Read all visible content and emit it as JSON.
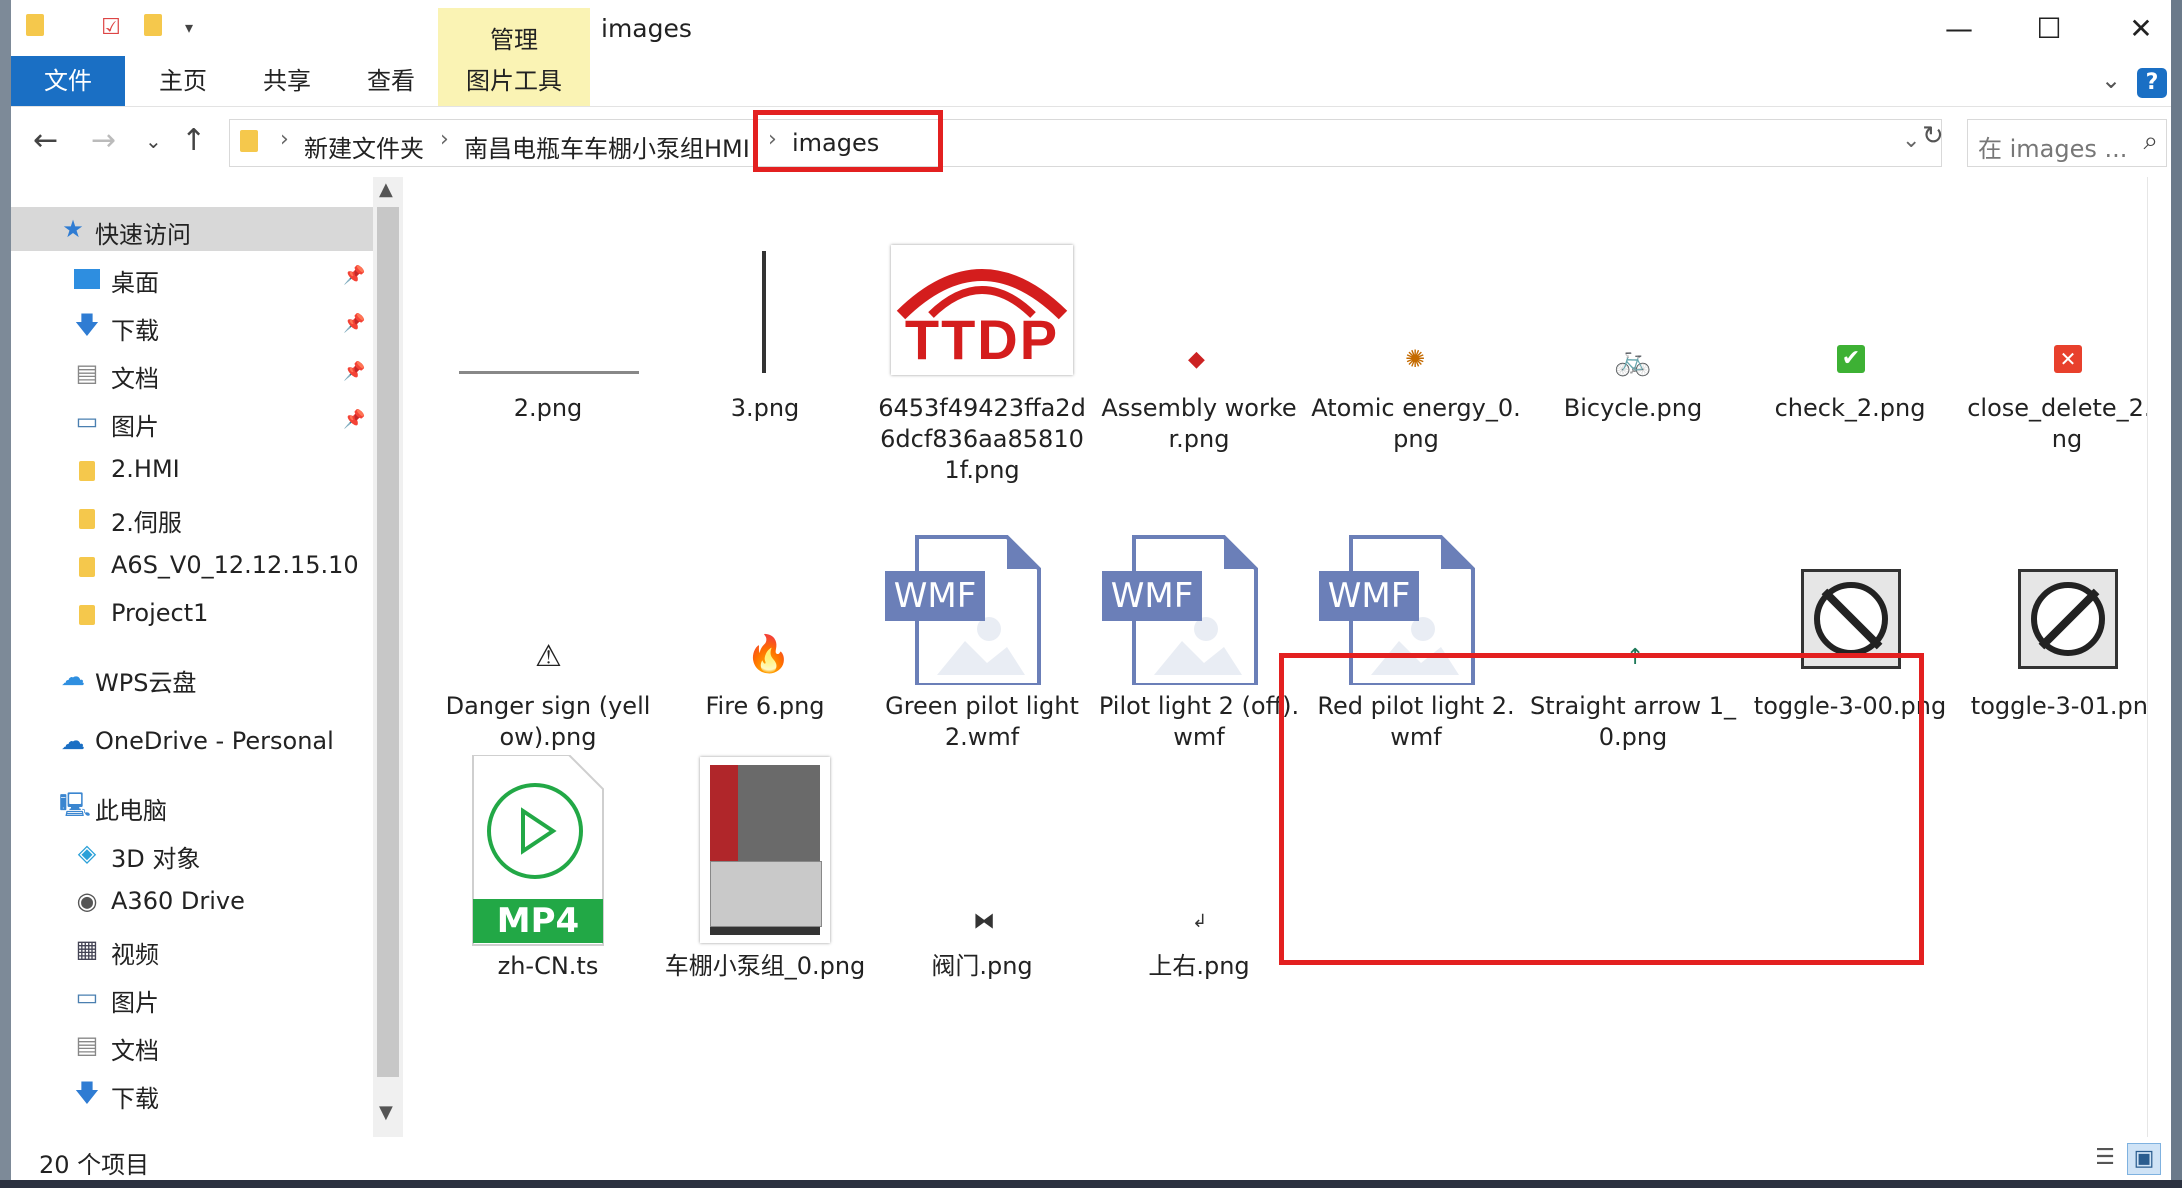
{
  "window": {
    "title": "images",
    "manage_tab": "管理",
    "controls": {
      "minimize": "—",
      "maximize": "☐",
      "close": "✕"
    }
  },
  "ribbon": {
    "tabs": [
      "文件",
      "主页",
      "共享",
      "查看",
      "图片工具"
    ],
    "help": "?",
    "collapse": "⌄"
  },
  "address": {
    "crumbs": [
      "新建文件夹",
      "南昌电瓶车车棚小泵组HMI",
      "images"
    ],
    "search_placeholder": "在 images ...",
    "refresh": "↻"
  },
  "navigation": {
    "items": [
      {
        "label": "快速访问",
        "icon": "star-icon",
        "level": 0,
        "selected": true
      },
      {
        "label": "桌面",
        "icon": "desktop-icon",
        "level": 1,
        "pinned": true
      },
      {
        "label": "下载",
        "icon": "download-icon",
        "level": 1,
        "pinned": true
      },
      {
        "label": "文档",
        "icon": "document-icon",
        "level": 1,
        "pinned": true
      },
      {
        "label": "图片",
        "icon": "pictures-icon",
        "level": 1,
        "pinned": true
      },
      {
        "label": "2.HMI",
        "icon": "folder-icon",
        "level": 1
      },
      {
        "label": "2.伺服",
        "icon": "folder-icon",
        "level": 1
      },
      {
        "label": "A6S_V0_12.12.15.10",
        "icon": "folder-icon",
        "level": 1
      },
      {
        "label": "Project1",
        "icon": "folder-icon",
        "level": 1
      },
      {
        "label": "WPS云盘",
        "icon": "cloud-icon",
        "level": 0
      },
      {
        "label": "OneDrive - Personal",
        "icon": "onedrive-icon",
        "level": 0
      },
      {
        "label": "此电脑",
        "icon": "computer-icon",
        "level": 0
      },
      {
        "label": "3D 对象",
        "icon": "cube-icon",
        "level": 1
      },
      {
        "label": "A360 Drive",
        "icon": "drive-icon",
        "level": 1
      },
      {
        "label": "视频",
        "icon": "video-icon",
        "level": 1
      },
      {
        "label": "图片",
        "icon": "pictures-icon",
        "level": 1
      },
      {
        "label": "文档",
        "icon": "document-icon",
        "level": 1
      },
      {
        "label": "下载",
        "icon": "download-icon",
        "level": 1
      }
    ]
  },
  "files": [
    {
      "name": "2.png",
      "icon": "horizontal-line-icon"
    },
    {
      "name": "3.png",
      "icon": "vertical-line-icon"
    },
    {
      "name": "6453f49423ffa2d6dcf836aa858101f.png",
      "icon": "ttdp-logo-icon",
      "logo_text": "TTDP"
    },
    {
      "name": "Assembly worker.png",
      "icon": "worker-icon"
    },
    {
      "name": "Atomic energy_0.png",
      "icon": "atom-icon"
    },
    {
      "name": "Bicycle.png",
      "icon": "bicycle-icon"
    },
    {
      "name": "check_2.png",
      "icon": "check-icon"
    },
    {
      "name": "close_delete_2.png",
      "icon": "close-delete-icon"
    },
    {
      "name": "Danger sign (yellow).png",
      "icon": "warning-icon"
    },
    {
      "name": "Fire 6.png",
      "icon": "fire-icon"
    },
    {
      "name": "Green pilot light 2.wmf",
      "icon": "wmf-file-icon",
      "badge": "WMF"
    },
    {
      "name": "Pilot light 2 (off).wmf",
      "icon": "wmf-file-icon",
      "badge": "WMF"
    },
    {
      "name": "Red pilot light 2.wmf",
      "icon": "wmf-file-icon",
      "badge": "WMF"
    },
    {
      "name": "Straight arrow 1_0.png",
      "icon": "arrow-up-icon"
    },
    {
      "name": "toggle-3-00.png",
      "icon": "toggle-switch-icon"
    },
    {
      "name": "toggle-3-01.png",
      "icon": "toggle-switch-icon"
    },
    {
      "name": "zh-CN.ts",
      "icon": "mp4-file-icon",
      "badge": "MP4"
    },
    {
      "name": "车棚小泵组_0.png",
      "icon": "cabinet-icon"
    },
    {
      "name": "阀门.png",
      "icon": "valve-icon"
    },
    {
      "name": "上右.png",
      "icon": "elbow-pipe-icon"
    }
  ],
  "status": {
    "count": "20 个项目"
  },
  "colors": {
    "accent": "#1a6fc4",
    "tools_tab": "#faf3b4",
    "highlight": "#e32020"
  }
}
